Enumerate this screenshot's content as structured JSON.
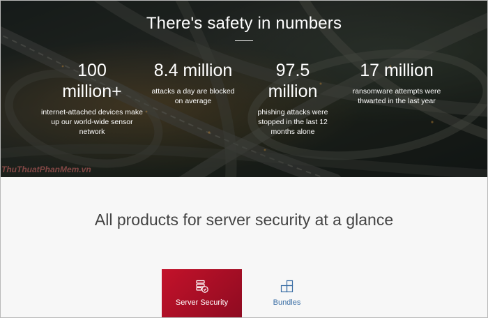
{
  "hero": {
    "title": "There's safety in numbers",
    "stats": [
      {
        "number": "100 million+",
        "description": "internet-attached devices make up our world-wide sensor network"
      },
      {
        "number": "8.4 million",
        "description": "attacks a day are blocked on average"
      },
      {
        "number": "97.5 million",
        "description": "phishing attacks were stopped in the last 12 months alone"
      },
      {
        "number": "17 million",
        "description": "ransomware attempts were thwarted in the last year"
      }
    ],
    "watermark": "ThuThuatPhanMem.vn"
  },
  "products": {
    "title": "All products for server security at a glance",
    "tabs": [
      {
        "label": "Server Security",
        "icon": "server-shield-icon"
      },
      {
        "label": "Bundles",
        "icon": "bundles-icon"
      }
    ]
  },
  "colors": {
    "accent": "#c3122a",
    "link": "#3a6ea5"
  }
}
